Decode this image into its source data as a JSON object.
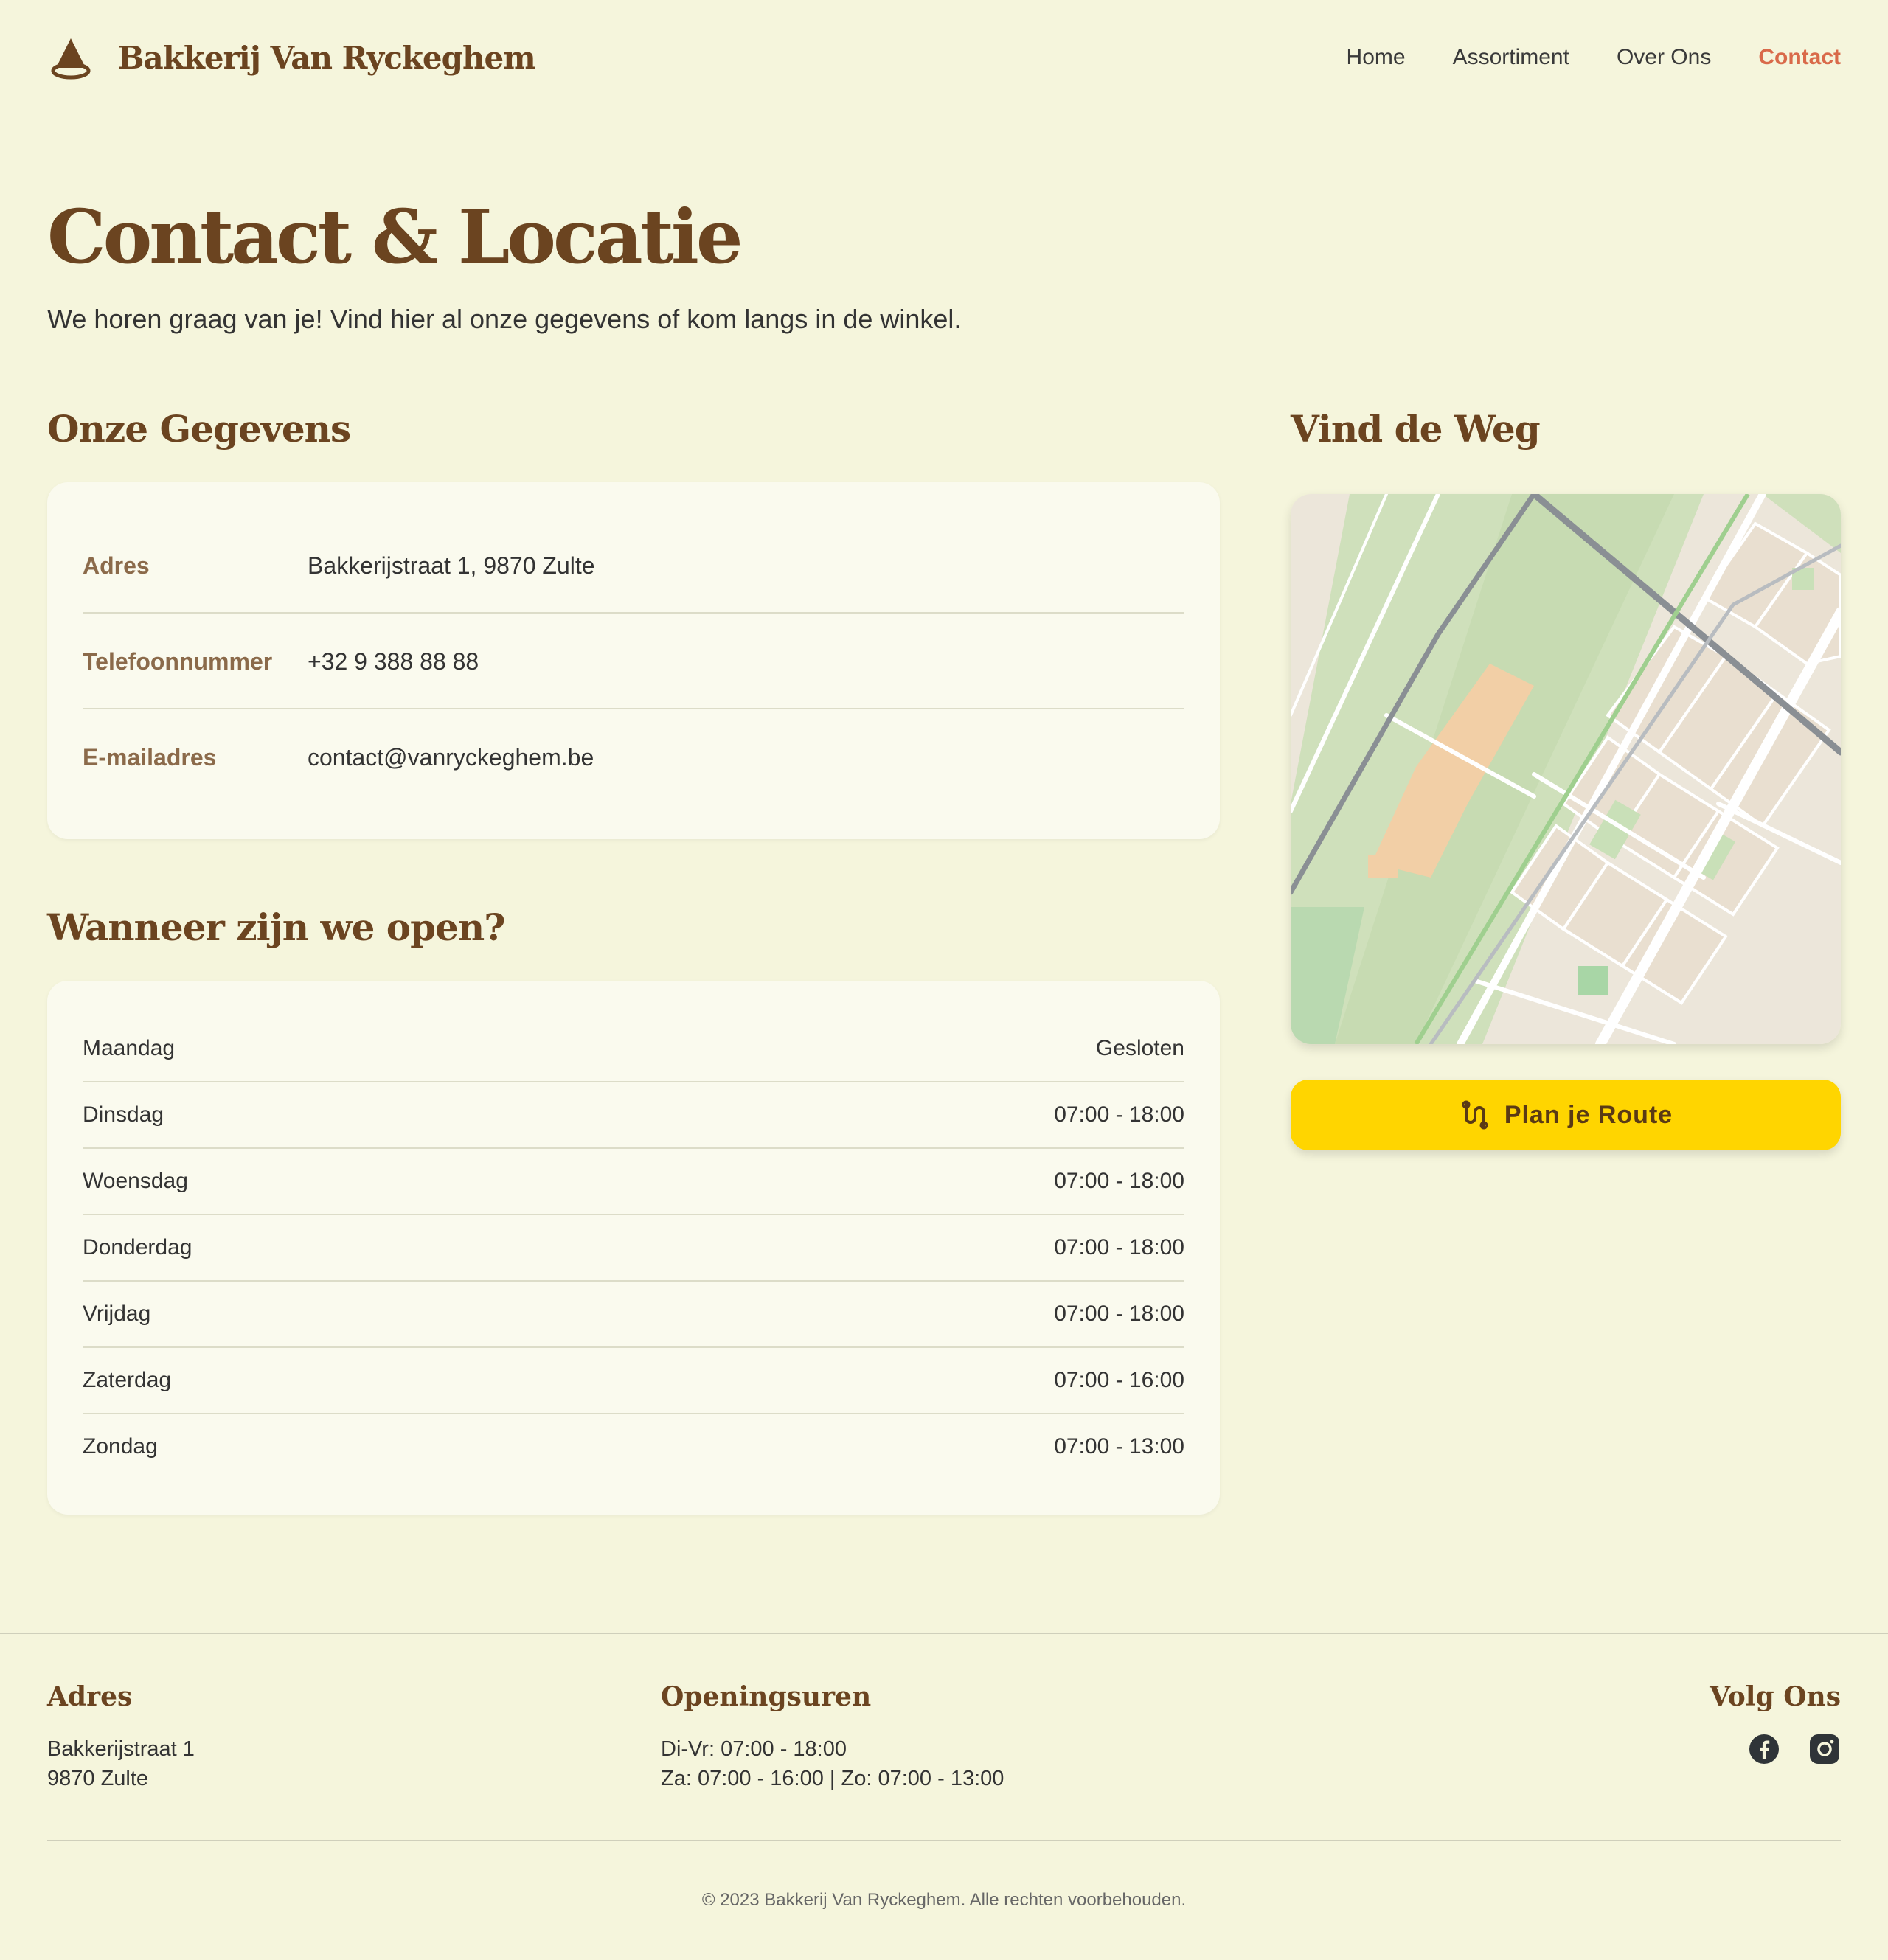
{
  "brand": {
    "name": "Bakkerij Van Ryckeghem",
    "logo_icon": "bakery-cone-icon"
  },
  "nav": {
    "items": [
      "Home",
      "Assortiment",
      "Over Ons",
      "Contact"
    ],
    "active": "Contact"
  },
  "hero": {
    "title": "Contact & Locatie",
    "subtitle": "We horen graag van je! Vind hier al onze gegevens of kom langs in de winkel."
  },
  "contact": {
    "title": "Onze Gegevens",
    "rows": [
      {
        "label": "Adres",
        "value": "Bakkerijstraat 1, 9870 Zulte"
      },
      {
        "label": "Telefoonnummer",
        "value": "+32 9 388 88 88"
      },
      {
        "label": "E-mailadres",
        "value": "contact@vanryckeghem.be"
      }
    ]
  },
  "hours": {
    "title": "Wanneer zijn we open?",
    "rows": [
      {
        "day": "Maandag",
        "time": "Gesloten"
      },
      {
        "day": "Dinsdag",
        "time": "07:00 - 18:00"
      },
      {
        "day": "Woensdag",
        "time": "07:00 - 18:00"
      },
      {
        "day": "Donderdag",
        "time": "07:00 - 18:00"
      },
      {
        "day": "Vrijdag",
        "time": "07:00 - 18:00"
      },
      {
        "day": "Zaterdag",
        "time": "07:00 - 16:00"
      },
      {
        "day": "Zondag",
        "time": "07:00 - 13:00"
      }
    ]
  },
  "map": {
    "title": "Vind de Weg",
    "button_label": "Plan je Route",
    "button_icon": "route-icon"
  },
  "footer": {
    "address_title": "Adres",
    "address_line1": "Bakkerijstraat 1",
    "address_line2": "9870 Zulte",
    "hours_title": "Openingsuren",
    "hours_line1": "Di-Vr: 07:00 - 18:00",
    "hours_line2": "Za: 07:00 - 16:00 | Zo: 07:00 - 13:00",
    "social_title": "Volg Ons",
    "social_icons": [
      "facebook-icon",
      "instagram-icon"
    ],
    "copyright": "© 2023 Bakkerij Van Ryckeghem. Alle rechten voorbehouden."
  },
  "colors": {
    "background": "#f5f5dc",
    "brown": "#6b4420",
    "accent": "#d96a4a",
    "button": "#ffd500"
  }
}
